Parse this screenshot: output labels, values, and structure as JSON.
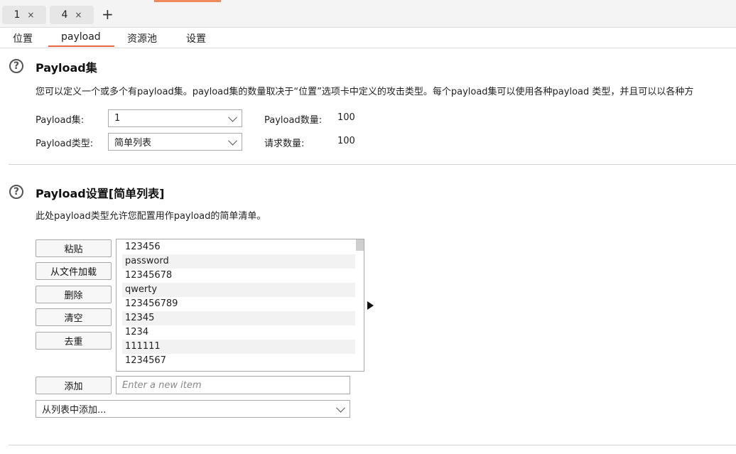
{
  "request_tabs": [
    {
      "label": "1",
      "close": "×"
    },
    {
      "label": "4",
      "close": "×"
    }
  ],
  "add_tab": "+",
  "sub_tabs": [
    "位置",
    "payload",
    "资源池",
    "设置"
  ],
  "active_sub_tab": "payload",
  "payload_sets": {
    "help": "?",
    "title": "Payload集",
    "description": "您可以定义一个或多个有payload集。payload集的数量取决于“位置”选项卡中定义的攻击类型。每个payload集可以使用各种payload 类型，并且可以以各种方",
    "set_label": "Payload集:",
    "set_value": "1",
    "type_label": "Payload类型:",
    "type_value": "简单列表",
    "count_label": "Payload数量:",
    "count_value": "100",
    "request_label": "请求数量:",
    "request_value": "100"
  },
  "payload_settings": {
    "help": "?",
    "title": "Payload设置[简单列表]",
    "description": "此处payload类型允许您配置用作payload的简单清单。",
    "buttons": {
      "paste": "粘贴",
      "load": "从文件加载",
      "remove": "删除",
      "clear": "清空",
      "dedupe": "去重",
      "add": "添加"
    },
    "items": [
      "123456",
      "password",
      "12345678",
      "qwerty",
      "123456789",
      "12345",
      "1234",
      "111111",
      "1234567"
    ],
    "new_item_placeholder": "Enter a new item",
    "add_from_list": "从列表中添加..."
  }
}
